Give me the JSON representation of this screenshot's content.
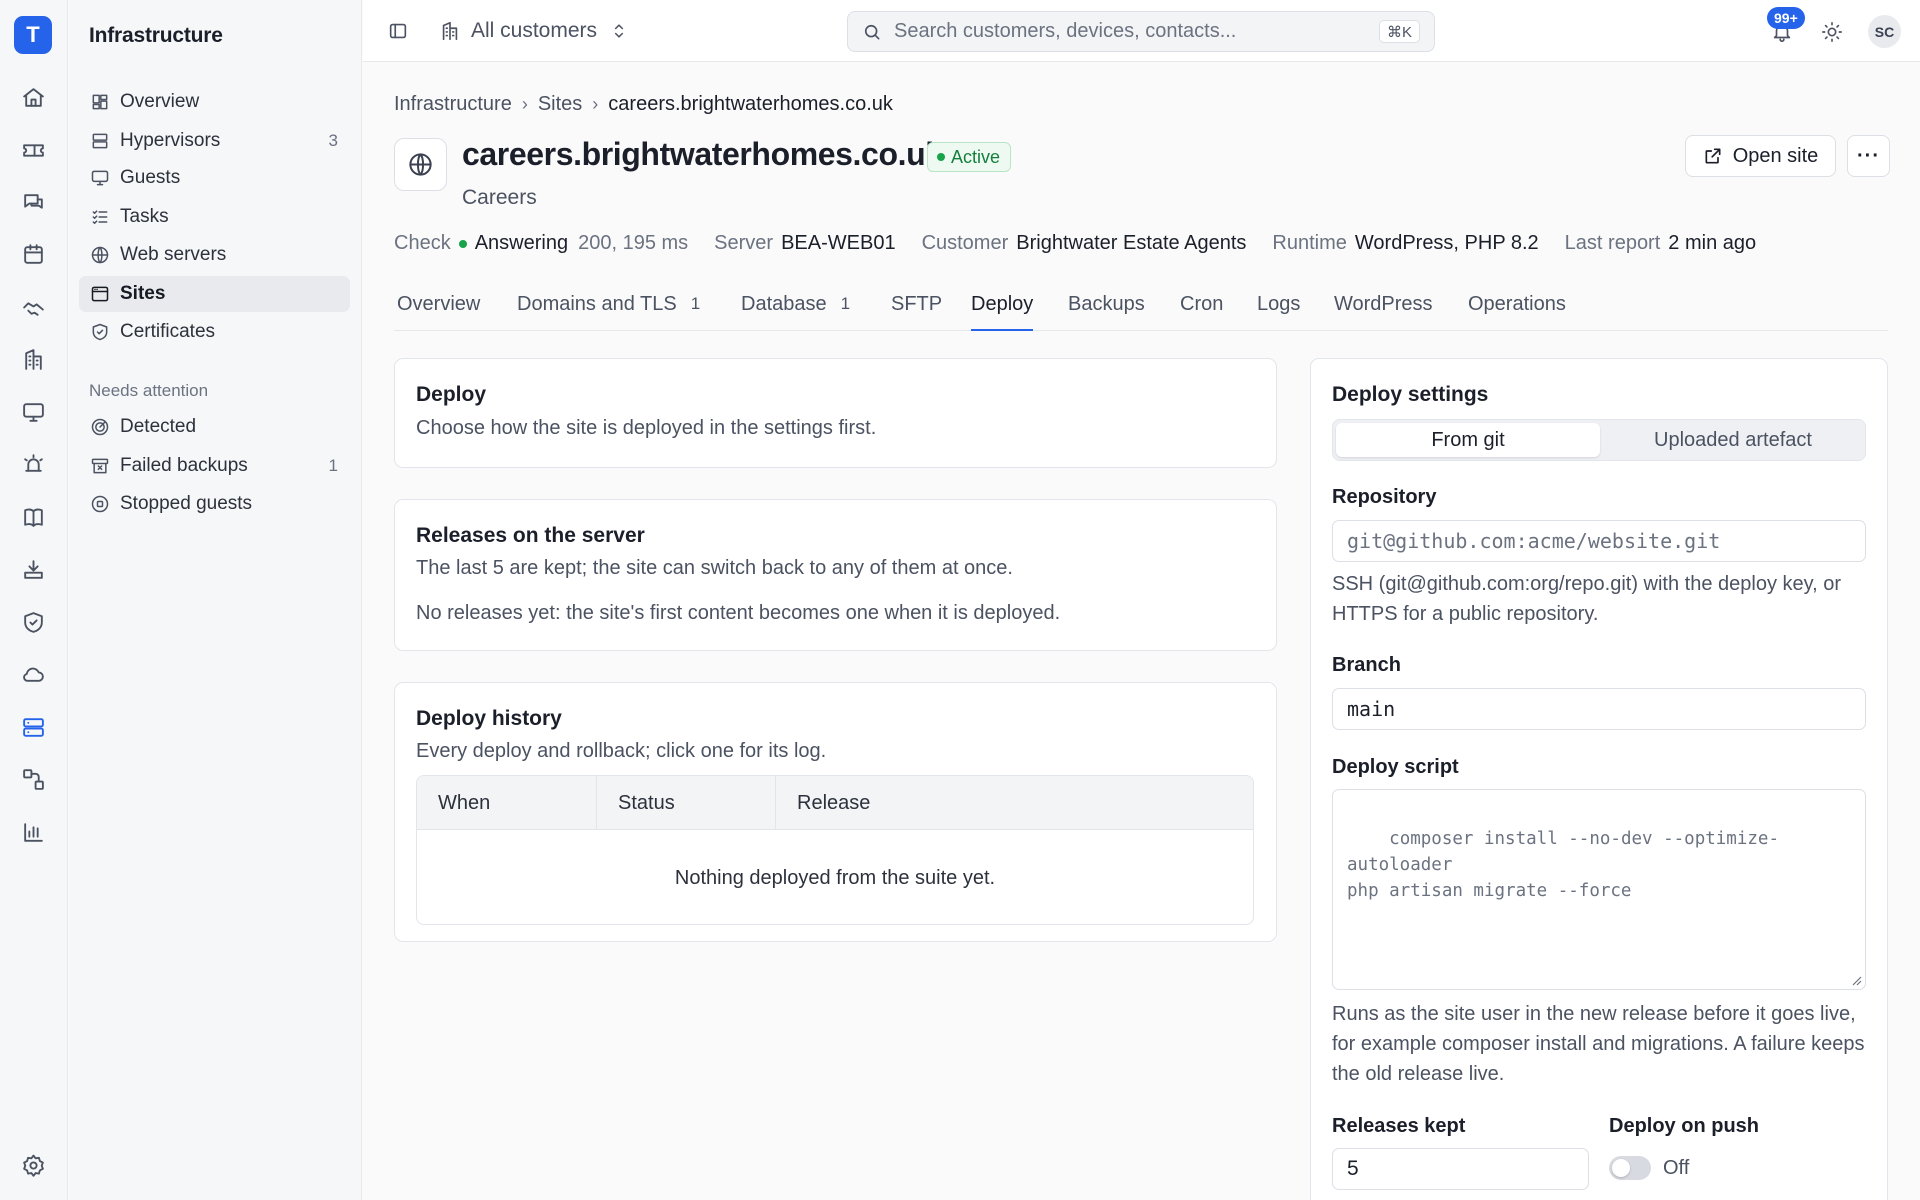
{
  "app": {
    "logo_letter": "T"
  },
  "sidebar": {
    "title": "Infrastructure",
    "items": [
      {
        "label": "Overview",
        "count": ""
      },
      {
        "label": "Hypervisors",
        "count": "3"
      },
      {
        "label": "Guests",
        "count": ""
      },
      {
        "label": "Tasks",
        "count": ""
      },
      {
        "label": "Web servers",
        "count": ""
      },
      {
        "label": "Sites",
        "count": ""
      },
      {
        "label": "Certificates",
        "count": ""
      }
    ],
    "attention_title": "Needs attention",
    "attention_items": [
      {
        "label": "Detected",
        "count": ""
      },
      {
        "label": "Failed backups",
        "count": "1"
      },
      {
        "label": "Stopped guests",
        "count": ""
      }
    ]
  },
  "topbar": {
    "customer": "All customers",
    "search_placeholder": "Search customers, devices, contacts...",
    "search_shortcut": "⌘K",
    "notifications_badge": "99+",
    "avatar_initials": "SC"
  },
  "breadcrumb": [
    "Infrastructure",
    "Sites",
    "careers.brightwaterhomes.co.uk"
  ],
  "site": {
    "title": "careers.brightwaterhomes.co.uk",
    "status": "Active",
    "subtitle": "Careers",
    "open_label": "Open site",
    "more_label": "···"
  },
  "meta": {
    "check_label": "Check",
    "check_value": "Answering",
    "check_detail": "200, 195 ms",
    "server_label": "Server",
    "server_value": "BEA-WEB01",
    "customer_label": "Customer",
    "customer_value": "Brightwater Estate Agents",
    "runtime_label": "Runtime",
    "runtime_value": "WordPress, PHP 8.2",
    "report_label": "Last report",
    "report_value": "2 min ago"
  },
  "tabs": [
    {
      "label": "Overview",
      "count": ""
    },
    {
      "label": "Domains and TLS",
      "count": "1"
    },
    {
      "label": "Database",
      "count": "1"
    },
    {
      "label": "SFTP",
      "count": ""
    },
    {
      "label": "Deploy",
      "count": ""
    },
    {
      "label": "Backups",
      "count": ""
    },
    {
      "label": "Cron",
      "count": ""
    },
    {
      "label": "Logs",
      "count": ""
    },
    {
      "label": "WordPress",
      "count": ""
    },
    {
      "label": "Operations",
      "count": ""
    }
  ],
  "deploy_card": {
    "title": "Deploy",
    "text": "Choose how the site is deployed in the settings first."
  },
  "releases_card": {
    "title": "Releases on the server",
    "text": "The last 5 are kept; the site can switch back to any of them at once.",
    "empty": "No releases yet: the site's first content becomes one when it is deployed."
  },
  "history_card": {
    "title": "Deploy history",
    "text": "Every deploy and rollback; click one for its log.",
    "columns": [
      "When",
      "Status",
      "Release"
    ],
    "empty": "Nothing deployed from the suite yet."
  },
  "settings": {
    "title": "Deploy settings",
    "modes": [
      "From git",
      "Uploaded artefact"
    ],
    "repo_label": "Repository",
    "repo_placeholder": "git@github.com:acme/website.git",
    "repo_help": "SSH (git@github.com:org/repo.git) with the deploy key, or HTTPS for a public repository.",
    "branch_label": "Branch",
    "branch_value": "main",
    "script_label": "Deploy script",
    "script_placeholder": "composer install --no-dev --optimize-autoloader\nphp artisan migrate --force",
    "script_help": "Runs as the site user in the new release before it goes live, for example composer install and migrations. A failure keeps the old release live.",
    "releases_label": "Releases kept",
    "releases_value": "5",
    "push_label": "Deploy on push",
    "push_state": "Off"
  }
}
